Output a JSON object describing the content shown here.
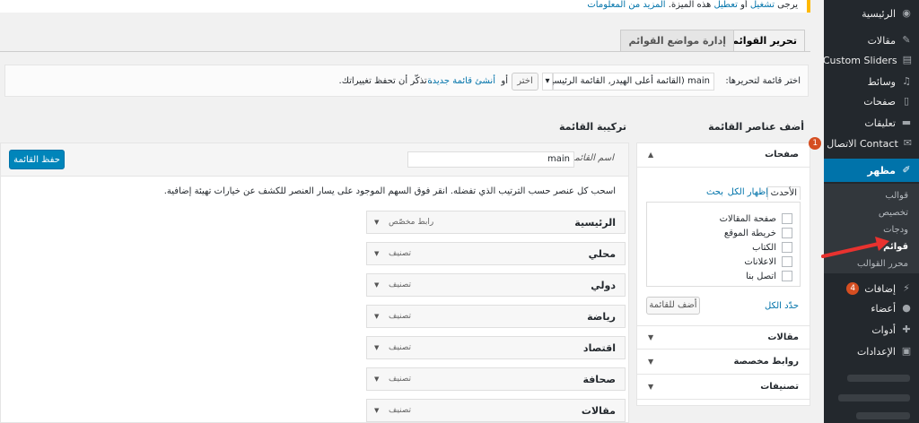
{
  "notice": {
    "prefix": "يرجى",
    "enable_link": "تشغيل",
    "or": "أو",
    "disable_link": "تعطيل",
    "middle": "هذه الميزة.",
    "more_link": "المزيد من المعلومات"
  },
  "sidebar": {
    "items": [
      {
        "label": "الرئيسية",
        "icon": "dashboard-icon"
      },
      {
        "label": "مقالات",
        "icon": "pin-icon"
      },
      {
        "label": "Custom Sliders",
        "icon": "slider-icon"
      },
      {
        "label": "وسائط",
        "icon": "media-icon"
      },
      {
        "label": "صفحات",
        "icon": "pages-icon"
      },
      {
        "label": "تعليقات",
        "icon": "comments-icon"
      },
      {
        "label": "الاتصال Contact",
        "icon": "mail-icon",
        "badge": "1"
      },
      {
        "label": "مظهر",
        "icon": "appearance-icon"
      },
      {
        "label": "إضافات",
        "icon": "plugins-icon",
        "badge": "4"
      },
      {
        "label": "أعضاء",
        "icon": "users-icon"
      },
      {
        "label": "أدوات",
        "icon": "tools-icon"
      },
      {
        "label": "الإعدادات",
        "icon": "settings-icon"
      }
    ],
    "submenu": [
      "قوالب",
      "تخصيص",
      "ودجات",
      "قوائم",
      "محرر القوالب"
    ],
    "accent": "#0073aa"
  },
  "tabs": [
    "تحرير القوائم",
    "إدارة مواضع القوائم"
  ],
  "selector": {
    "label": "اختر قائمة لتحريرها:",
    "value": "main (القائمة أعلى الهيدر, القائمة الرئيسية)",
    "select_button": "اختر",
    "or": "أو",
    "create_link": "أنشئ قائمة جديدة",
    "suffix": ". تذكّر أن تحفظ تغييراتك."
  },
  "add_items_heading": "أضف عناصر القائمة",
  "structure_heading": "تركيبة القائمة",
  "pages_box": {
    "title": "صفحات",
    "subtabs": [
      "الأحدث",
      "إظهار الكل",
      "بحث"
    ],
    "pages": [
      "صفحة المقالات",
      "خريطة الموقع",
      "الكتاب",
      "الاعلانات",
      "اتصل بنا"
    ],
    "select_all": "حدّد الكل",
    "add_button": "أضف للقائمة"
  },
  "other_boxes": [
    "مقالات",
    "روابط مخصصة",
    "تصنيفات"
  ],
  "structure": {
    "name_label": "اسم القائمة",
    "name_value": "main",
    "save_button": "حفظ القائمة",
    "instructions": "اسحب كل عنصر حسب الترتيب الذي تفضله. انقر فوق السهم الموجود على يسار العنصر للكشف عن خيارات تهيئة إضافية.",
    "items": [
      {
        "title": "الرئيسية",
        "type": "رابط مخصّص"
      },
      {
        "title": "محلي",
        "type": "تصنيف"
      },
      {
        "title": "دولي",
        "type": "تصنيف"
      },
      {
        "title": "رياضة",
        "type": "تصنيف"
      },
      {
        "title": "اقتصاد",
        "type": "تصنيف"
      },
      {
        "title": "صحافة",
        "type": "تصنيف"
      },
      {
        "title": "مقالات",
        "type": "تصنيف"
      }
    ]
  },
  "colors": {
    "primary": "#0085ba",
    "arrow": "#e8322f",
    "notice": "#ffb900"
  }
}
